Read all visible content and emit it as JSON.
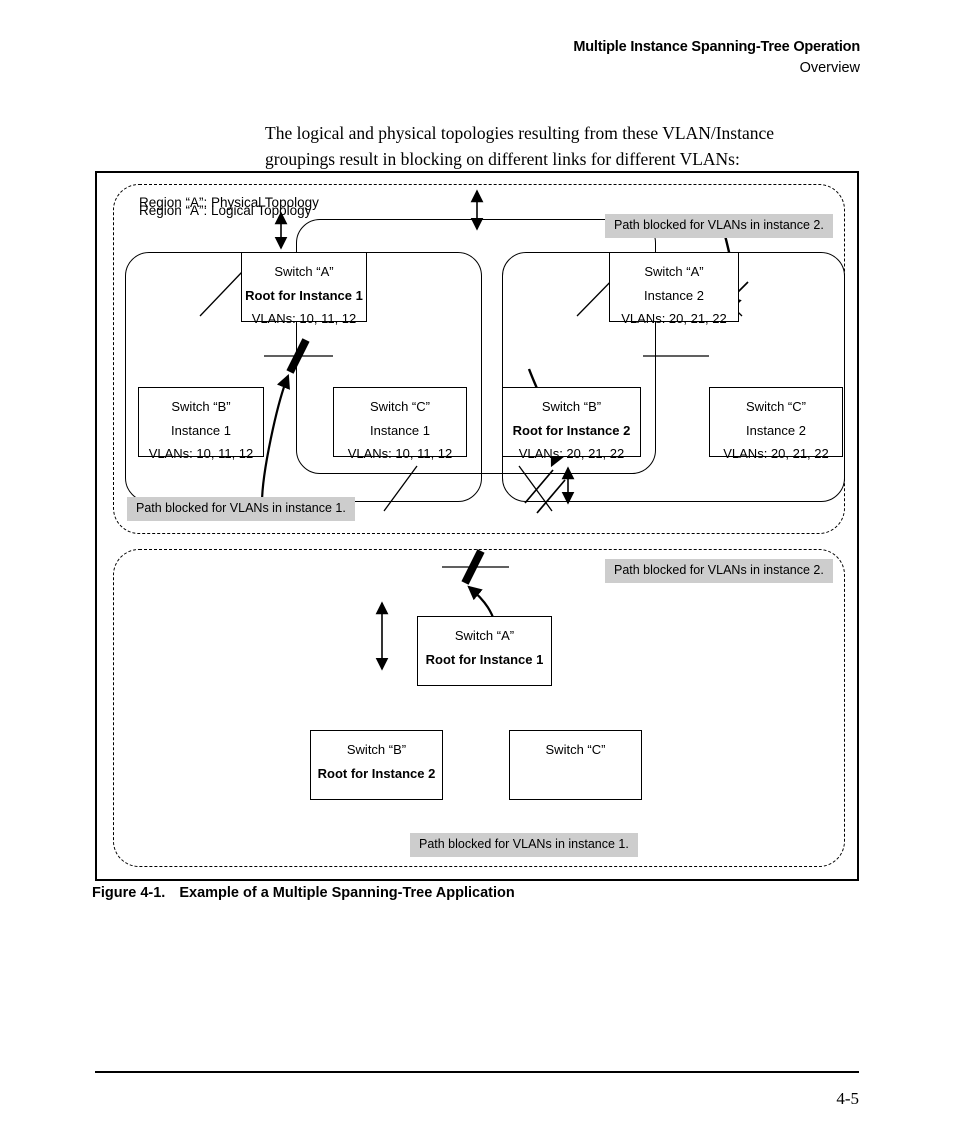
{
  "header": {
    "title": "Multiple Instance Spanning-Tree Operation",
    "subtitle": "Overview"
  },
  "intro": {
    "text": "The logical and physical topologies resulting from these VLAN/Instance groupings result in blocking on different links for different VLANs:"
  },
  "figure": {
    "caption_number": "Figure 4-1.",
    "caption_text": "Example of a Multiple Spanning-Tree Application",
    "logical": {
      "region_label": "Region “A”: Logical Topology",
      "instance1": {
        "switch_a": {
          "name": "Switch “A”",
          "role": "Root for Instance 1",
          "vlans": "VLANs: 10, 11, 12"
        },
        "switch_b": {
          "name": "Switch “B”",
          "role": "Instance 1",
          "vlans": "VLANs: 10, 11, 12"
        },
        "switch_c": {
          "name": "Switch “C”",
          "role": "Instance 1",
          "vlans": "VLANs: 10, 11, 12"
        },
        "callout": "Path blocked for VLANs in instance 1."
      },
      "instance2": {
        "switch_a": {
          "name": "Switch “A”",
          "role": "Instance 2",
          "vlans": "VLANs: 20, 21, 22"
        },
        "switch_b": {
          "name": "Switch “B”",
          "role": "Root for Instance 2",
          "vlans": "VLANs: 20, 21, 22"
        },
        "switch_c": {
          "name": "Switch “C”",
          "role": "Instance 2",
          "vlans": "VLANs: 20, 21, 22"
        },
        "callout": "Path blocked for VLANs in instance 2."
      }
    },
    "physical": {
      "region_label": "Region “A”: Physical Topology",
      "switch_a": {
        "name": "Switch “A”",
        "role": "Root for Instance 1"
      },
      "switch_b": {
        "name": "Switch “B”",
        "role": "Root for Instance 2"
      },
      "switch_c": {
        "name": "Switch “C”"
      },
      "callout_instance2": "Path blocked for VLANs in instance 2.",
      "callout_instance1": "Path blocked for VLANs in instance 1."
    }
  },
  "footer": {
    "page_number": "4-5"
  },
  "colors": {
    "callout_bg": "#cdcdcd",
    "line": "#000000",
    "page_bg": "#ffffff"
  }
}
